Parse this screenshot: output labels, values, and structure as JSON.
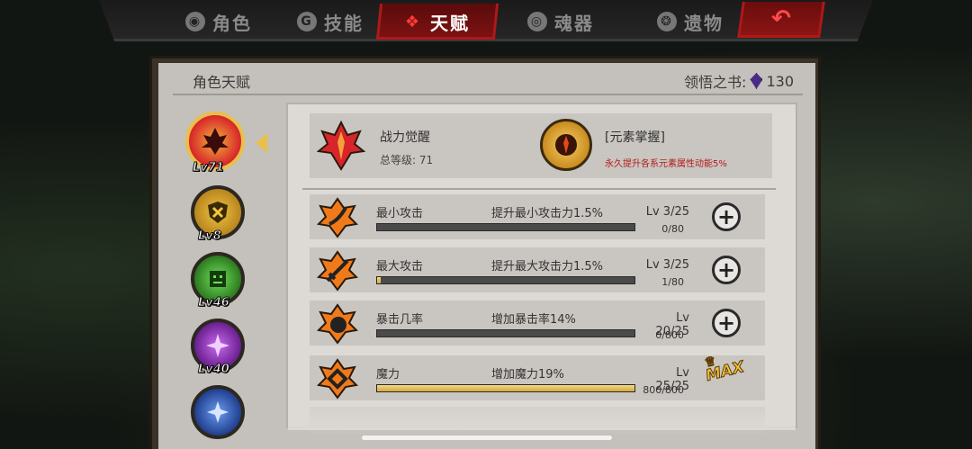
{
  "tabs": [
    {
      "label": "角色",
      "icon": "character-icon"
    },
    {
      "label": "技能",
      "icon": "skill-icon"
    },
    {
      "label": "天赋",
      "icon": "talent-icon",
      "active": true
    },
    {
      "label": "魂器",
      "icon": "soul-artifact-icon"
    },
    {
      "label": "遗物",
      "icon": "relic-icon"
    }
  ],
  "panel": {
    "title": "角色天赋",
    "book_label": "领悟之书:",
    "book_count": "130"
  },
  "avatars": [
    {
      "level": "Lv71",
      "color": "#d8242a",
      "selected": true
    },
    {
      "level": "Lv8",
      "color": "#c8962a"
    },
    {
      "level": "Lv46",
      "color": "#3c9a2e"
    },
    {
      "level": "Lv40",
      "color": "#8e2fb5"
    },
    {
      "level": "",
      "color": "#2f5fb8"
    }
  ],
  "header": {
    "name": "战力觉醒",
    "total_level": "总等级: 71",
    "element": "[元素掌握]",
    "element_desc": "永久提升各系元素属性动能5%"
  },
  "talents": [
    {
      "name": "最小攻击",
      "desc": "提升最小攻击力1.5%",
      "level": "Lv 3/25",
      "points": "0/80",
      "progress": 0.0,
      "maxed": false
    },
    {
      "name": "最大攻击",
      "desc": "提升最大攻击力1.5%",
      "level": "Lv 3/25",
      "points": "1/80",
      "progress": 0.0125,
      "maxed": false
    },
    {
      "name": "暴击几率",
      "desc": "增加暴击率14%",
      "level": "Lv 20/25",
      "points": "0/800",
      "progress": 0.0,
      "maxed": false
    },
    {
      "name": "魔力",
      "desc": "增加魔力19%",
      "level": "Lv 25/25",
      "points": "800/800",
      "progress": 1.0,
      "maxed": true
    }
  ],
  "max_label": "MAX",
  "colors": {
    "accent": "#b01818",
    "gold": "#e8c04a",
    "panel": "#c4c0bb"
  }
}
